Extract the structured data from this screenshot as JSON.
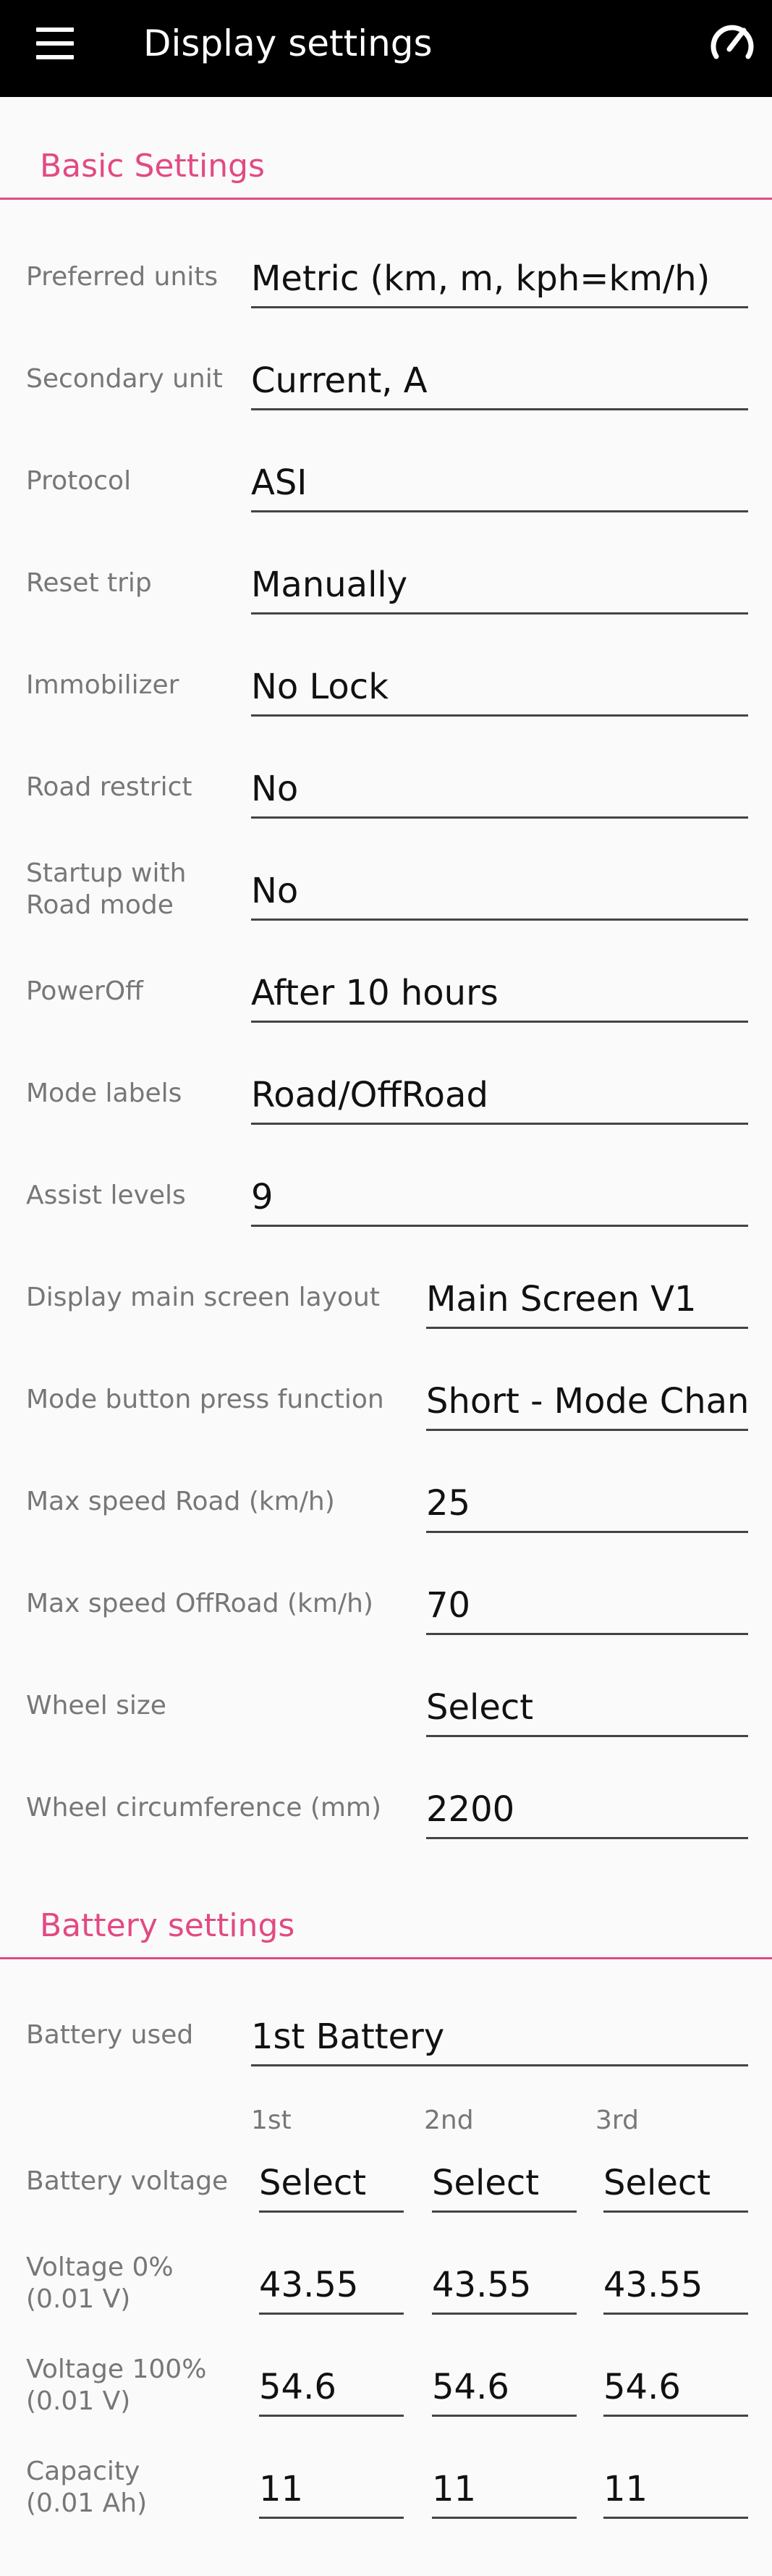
{
  "header": {
    "title": "Display settings",
    "menu_icon": "hamburger-menu-icon",
    "action_icon": "speedometer-icon"
  },
  "colors": {
    "appbar": "#000000",
    "accent": "#e24a83",
    "background": "#fafafa"
  },
  "basic": {
    "title": "Basic Settings",
    "settings": [
      {
        "label": "Preferred units",
        "value": "Metric (km, m, kph=km/h)"
      },
      {
        "label": "Secondary unit",
        "value": "Current, A"
      },
      {
        "label": "Protocol",
        "value": "ASI"
      },
      {
        "label": "Reset trip",
        "value": "Manually"
      },
      {
        "label": "Immobilizer",
        "value": "No Lock"
      },
      {
        "label": "Road restrict",
        "value": "No"
      },
      {
        "label": "Startup with\nRoad mode",
        "value": "No"
      },
      {
        "label": "PowerOff",
        "value": "After 10 hours"
      },
      {
        "label": "Mode labels",
        "value": "Road/OffRoad"
      },
      {
        "label": "Assist levels",
        "value": "9"
      },
      {
        "label": "Display main screen layout",
        "value": "Main Screen V1"
      },
      {
        "label": "Mode button press function",
        "value": "Short - Mode Change"
      },
      {
        "label": "Max speed Road (km/h)",
        "value": "25"
      },
      {
        "label": "Max speed OffRoad (km/h)",
        "value": "70"
      },
      {
        "label": "Wheel size",
        "value": "Select"
      },
      {
        "label": "Wheel circumference (mm)",
        "value": "2200"
      }
    ]
  },
  "battery": {
    "title": "Battery settings",
    "used_label": "Battery used",
    "used_value": "1st Battery",
    "columns": [
      "1st",
      "2nd",
      "3rd"
    ],
    "rows": [
      {
        "label": "Battery voltage",
        "values": [
          "Select",
          "Select",
          "Select"
        ]
      },
      {
        "label": "Voltage 0%\n(0.01 V)",
        "values": [
          "43.55",
          "43.55",
          "43.55"
        ]
      },
      {
        "label": "Voltage 100%\n(0.01 V)",
        "values": [
          "54.6",
          "54.6",
          "54.6"
        ]
      },
      {
        "label": "Capacity\n(0.01 Ah)",
        "values": [
          "11",
          "11",
          "11"
        ]
      }
    ]
  }
}
